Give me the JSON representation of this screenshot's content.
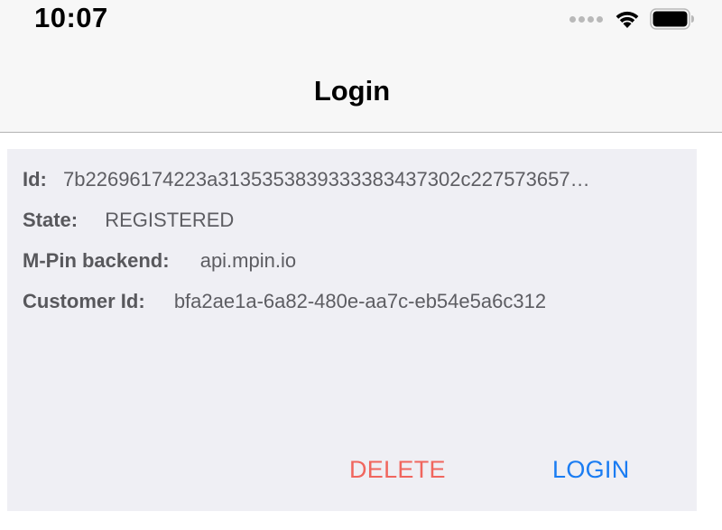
{
  "status_bar": {
    "time": "10:07",
    "icons": [
      "cellular-dots-icon",
      "wifi-icon",
      "battery-icon"
    ]
  },
  "nav": {
    "title": "Login"
  },
  "user": {
    "id_label": "Id:",
    "id_value": "7b22696174223a3135353839333383437302c227573657…",
    "state_label": "State:",
    "state_value": "REGISTERED",
    "backend_label": "M-Pin backend:",
    "backend_value": "api.mpin.io",
    "customer_label": "Customer Id:",
    "customer_value": "bfa2ae1a-6a82-480e-aa7c-eb54e5a6c312"
  },
  "actions": {
    "delete_label": "DELETE",
    "login_label": "LOGIN"
  },
  "colors": {
    "delete": "#f0665e",
    "login": "#1a7cf2",
    "card_bg": "#efeff4",
    "bar_bg": "#f7f7f7"
  }
}
